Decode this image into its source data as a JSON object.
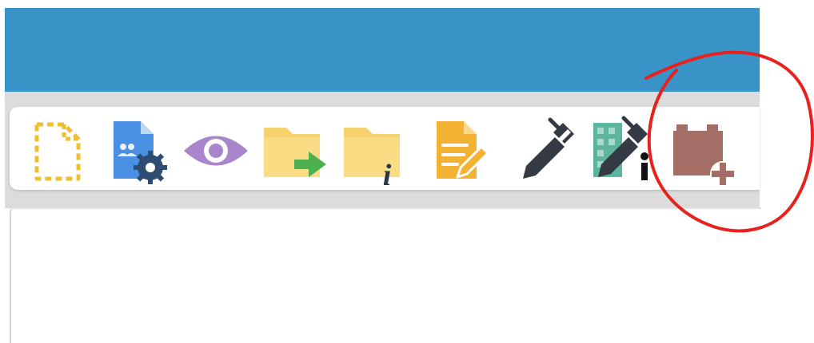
{
  "colors": {
    "header": "#3a93c7",
    "toolbar_background": "#dcdcdc",
    "annotation": "#e8201e"
  },
  "toolbar": {
    "buttons": [
      {
        "icon": "new-document-dashed-icon",
        "color": "#f0bf2f"
      },
      {
        "icon": "document-users-settings-icon",
        "color": "#4a90e2"
      },
      {
        "icon": "eye-icon",
        "color": "#a985cc"
      },
      {
        "icon": "folder-move-icon",
        "color": "#f6d26e"
      },
      {
        "icon": "folder-info-icon",
        "color": "#f6d26e"
      },
      {
        "icon": "document-edit-icon",
        "color": "#f4b234"
      },
      {
        "icon": "pen-icon",
        "color": "#333a44"
      },
      {
        "icon": "pen-building-icon",
        "color": "#5db5a0"
      },
      {
        "icon": "block-add-icon",
        "color": "#a46e66"
      }
    ]
  },
  "annotation": {
    "shape": "hand-drawn circle",
    "target": "block-add-icon"
  }
}
